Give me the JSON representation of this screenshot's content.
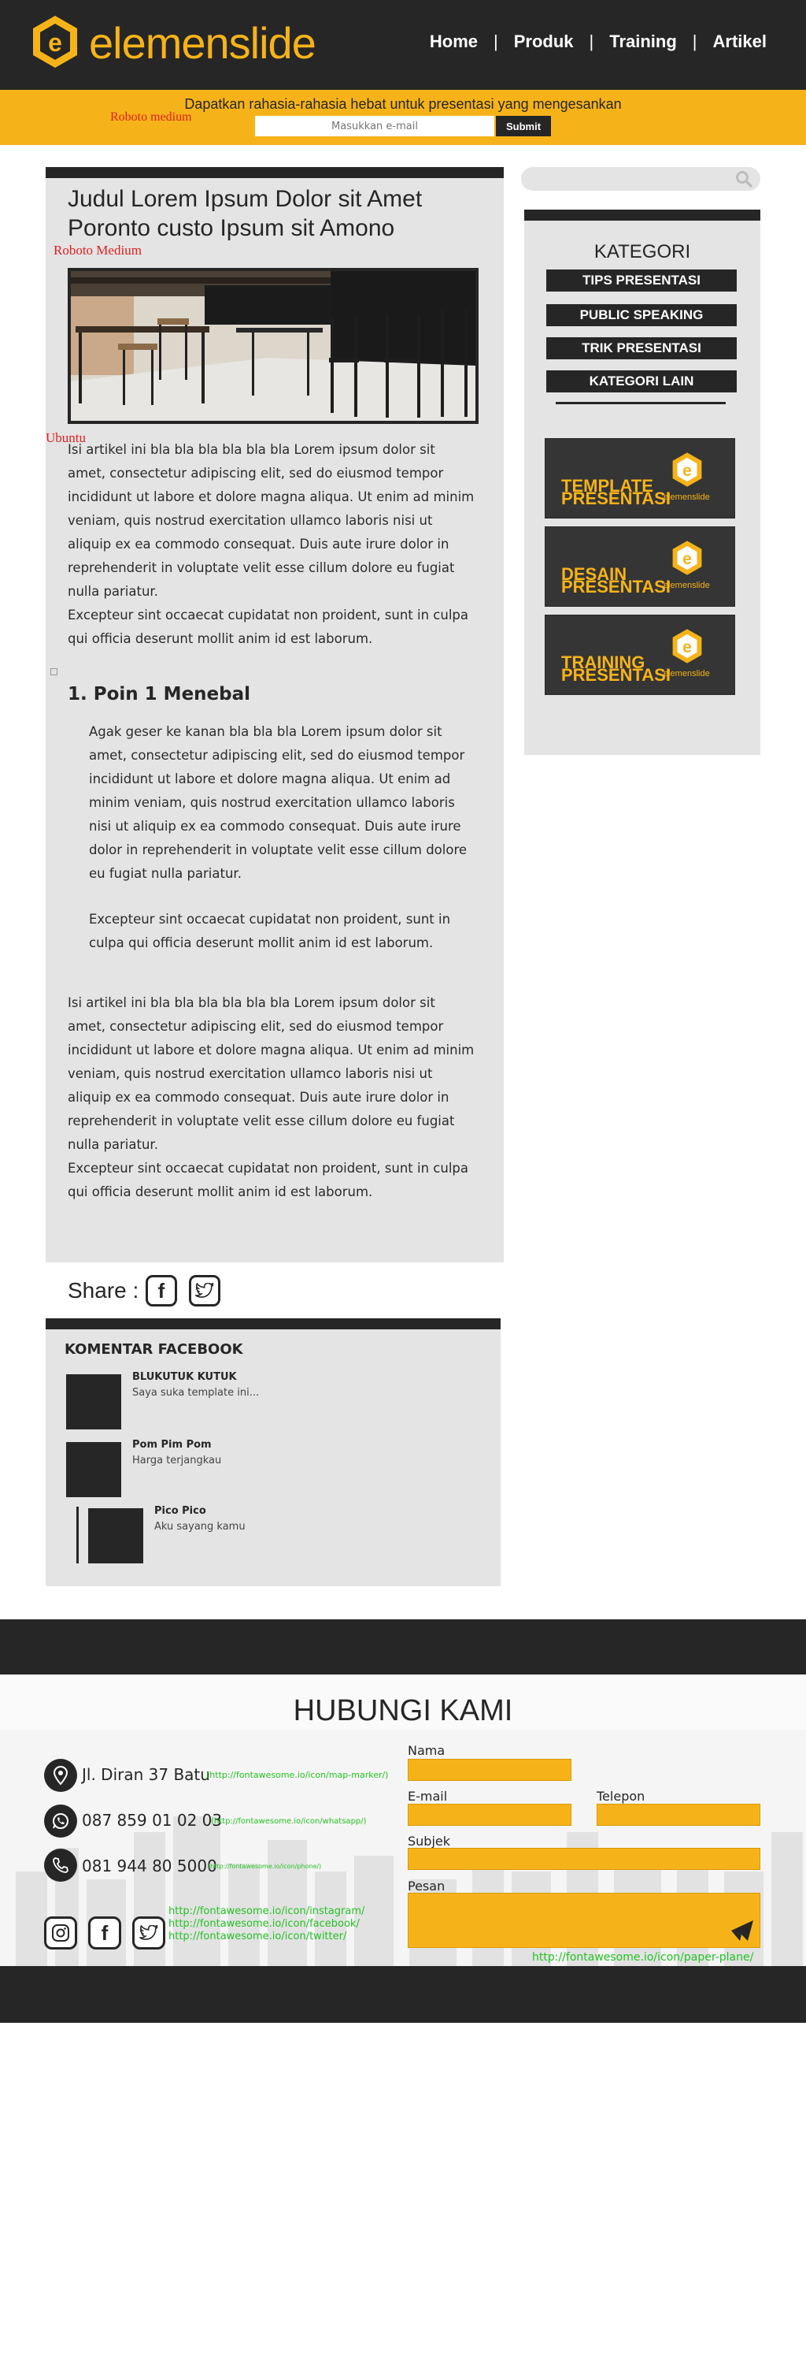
{
  "header": {
    "logo_text": "elemenslide",
    "nav": [
      "Home",
      "Produk",
      "Training",
      "Artikel"
    ],
    "nav_separator": "|"
  },
  "promo": {
    "headline": "Dapatkan rahasia-rahasia hebat untuk presentasi yang mengesankan",
    "email_placeholder": "Masukkan e-mail",
    "submit_label": "Submit"
  },
  "annotations": {
    "roboto_medium_1": "Roboto medium",
    "roboto_medium_2": "Roboto Medium",
    "ubuntu": "Ubuntu"
  },
  "article": {
    "title": "Judul Lorem Ipsum Dolor sit Amet Poronto custo Ipsum sit Amono",
    "para1": "Isi artikel ini bla bla bla bla bla bla Lorem ipsum dolor sit amet, consectetur adipiscing elit, sed do eiusmod tempor incididunt ut labore et dolore magna aliqua. Ut enim ad minim veniam, quis nostrud exercitation ullamco laboris nisi ut aliquip ex ea commodo consequat. Duis aute irure dolor in reprehenderit in voluptate velit esse cillum dolore eu fugiat nulla pariatur.",
    "para2": "Excepteur sint occaecat cupidatat non proident, sunt in culpa qui officia deserunt mollit anim id est laborum.",
    "heading1": "1. Poin 1 Menebal",
    "indent1": "Agak geser ke kanan bla bla bla Lorem ipsum dolor sit amet, consectetur adipiscing elit, sed do eiusmod tempor incididunt ut labore et dolore magna aliqua. Ut enim ad minim veniam, quis nostrud exercitation ullamco laboris nisi ut aliquip ex ea commodo consequat. Duis aute irure dolor in reprehenderit in voluptate velit esse cillum dolore eu fugiat nulla pariatur.",
    "indent2": "Excepteur sint occaecat cupidatat non proident, sunt in culpa qui officia deserunt mollit anim id est laborum.",
    "para3": "Isi artikel ini bla bla bla bla bla bla Lorem ipsum dolor sit amet, consectetur adipiscing elit, sed do eiusmod tempor incididunt ut labore et dolore magna aliqua. Ut enim ad minim veniam, quis nostrud exercitation ullamco laboris nisi ut aliquip ex ea commodo consequat. Duis aute irure dolor in reprehenderit in voluptate velit esse cillum dolore eu fugiat nulla pariatur.",
    "para4": "Excepteur sint occaecat cupidatat non proident, sunt in culpa qui officia deserunt mollit anim id est laborum."
  },
  "share": {
    "label": "Share :"
  },
  "comments": {
    "title": "KOMENTAR FACEBOOK",
    "items": [
      {
        "name": "BLUKUTUK KUTUK",
        "text": "Saya suka template ini..."
      },
      {
        "name": "Pom Pim Pom",
        "text": "Harga terjangkau"
      },
      {
        "name": "Pico Pico",
        "text": "Aku sayang kamu"
      }
    ]
  },
  "sidebar": {
    "kategori_title": "KATEGORI",
    "kategori": [
      "TIPS PRESENTASI",
      "PUBLIC SPEAKING",
      "TRIK PRESENTASI",
      "KATEGORI LAIN"
    ],
    "banners": [
      {
        "line1": "TEMPLATE",
        "line2": "PRESENTASI",
        "brand": "elemenslide"
      },
      {
        "line1": "DESAIN",
        "line2": "PRESENTASI",
        "brand": "elemenslide"
      },
      {
        "line1": "TRAINING",
        "line2": "PRESENTASI",
        "brand": "elemenslide"
      }
    ]
  },
  "contact": {
    "title": "HUBUNGI KAMI",
    "address": "Jl. Diran 37 Batu",
    "address_ref": "(http://fontawesome.io/icon/map-marker/)",
    "whatsapp": "087 859 01 02 03",
    "whatsapp_ref": "(http://fontawesome.io/icon/whatsapp/)",
    "phone": "081 944 80 5000",
    "phone_ref": "(http://fontawesome.io/icon/phone/)",
    "social_refs": [
      "http://fontawesome.io/icon/instagram/",
      "http://fontawesome.io/icon/facebook/",
      "http://fontawesome.io/icon/twitter/"
    ],
    "send_ref": "http://fontawesome.io/icon/paper-plane/",
    "form": {
      "nama": "Nama",
      "email": "E-mail",
      "telepon": "Telepon",
      "subjek": "Subjek",
      "pesan": "Pesan"
    }
  },
  "colors": {
    "accent": "#f6b319",
    "dark": "#262626",
    "panel": "#e4e4e4",
    "annotation": "#e02020",
    "link_note": "#25c125"
  }
}
